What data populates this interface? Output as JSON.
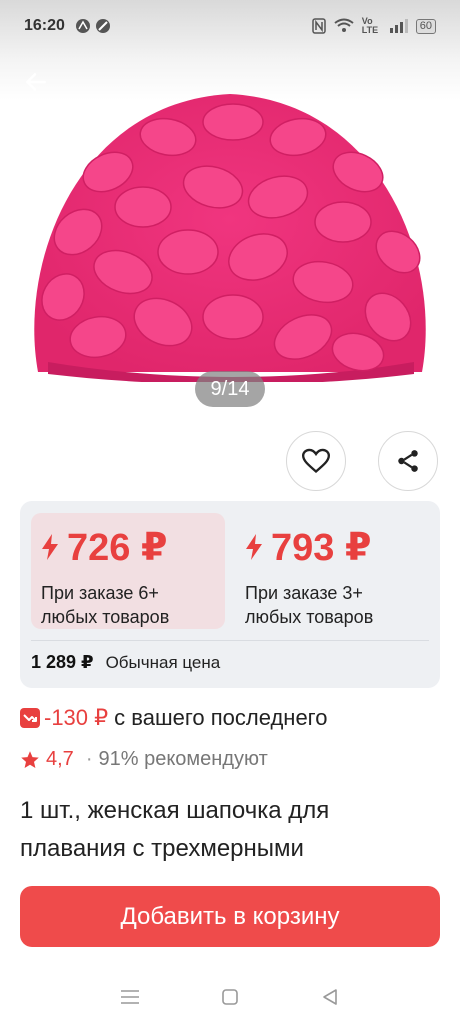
{
  "status_bar": {
    "time": "16:20",
    "network": "Vo LTE",
    "battery": "60"
  },
  "gallery": {
    "counter": "9/14",
    "image_icon": "pink-flower-swim-cap-image"
  },
  "colors": {
    "accent": "#e8403f",
    "cart_button": "#ef4b4b",
    "offer_highlight": "#f2dfe2",
    "card_bg": "#eef0f3"
  },
  "prices": {
    "offers": [
      {
        "price": "726 ₽",
        "condition": "При заказе 6+ любых товаров"
      },
      {
        "price": "793 ₽",
        "condition": "При заказе 3+ любых товаров"
      }
    ],
    "regular_value": "1 289 ₽",
    "regular_label": "Обычная цена"
  },
  "discount": {
    "amount": "-130 ₽",
    "text": "с вашего последнего"
  },
  "rating": {
    "value": "4,7",
    "dot": "·",
    "recommend": "91% рекомендуют"
  },
  "product": {
    "title": "1 шт., женская шапочка для плавания с трехмерными"
  },
  "actions": {
    "add_to_cart": "Добавить в корзину"
  }
}
